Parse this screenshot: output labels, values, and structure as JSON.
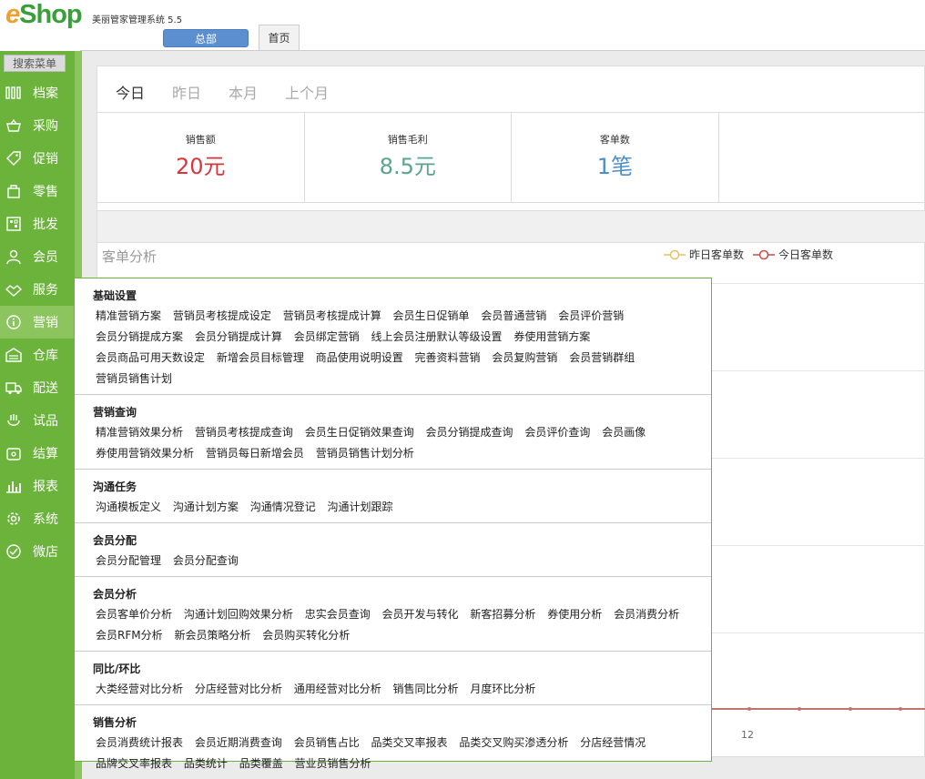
{
  "header": {
    "logo_e": "e",
    "logo_rest": "Shop",
    "subtitle": "美丽管家管理系统 5.5",
    "branch_button": "总部",
    "home_tab": "首页"
  },
  "sidebar": {
    "search_label": "搜索菜单",
    "items": [
      {
        "label": "档案",
        "icon": "barcode-icon"
      },
      {
        "label": "采购",
        "icon": "basket-icon"
      },
      {
        "label": "促销",
        "icon": "tag-icon"
      },
      {
        "label": "零售",
        "icon": "bag-icon"
      },
      {
        "label": "批发",
        "icon": "qr-icon"
      },
      {
        "label": "会员",
        "icon": "user-icon"
      },
      {
        "label": "服务",
        "icon": "handshake-icon"
      },
      {
        "label": "营销",
        "icon": "info-icon"
      },
      {
        "label": "仓库",
        "icon": "warehouse-icon"
      },
      {
        "label": "配送",
        "icon": "truck-icon"
      },
      {
        "label": "试品",
        "icon": "sample-icon"
      },
      {
        "label": "结算",
        "icon": "wallet-icon"
      },
      {
        "label": "报表",
        "icon": "barchart-icon"
      },
      {
        "label": "系统",
        "icon": "gear-icon"
      },
      {
        "label": "微店",
        "icon": "shop-icon"
      }
    ],
    "active": "营销"
  },
  "dashboard": {
    "periods": [
      "今日",
      "昨日",
      "本月",
      "上个月"
    ],
    "stats": [
      {
        "label": "销售额",
        "value": "20元",
        "color": "#d9353a"
      },
      {
        "label": "销售毛利",
        "value": "8.5元",
        "color": "#5aa58a"
      },
      {
        "label": "客单数",
        "value": "1笔",
        "color": "#4f8fc9"
      }
    ],
    "chart_title": "客单分析",
    "legend": [
      {
        "label": "昨日客单数",
        "color": "#e6c16a"
      },
      {
        "label": "今日客单数",
        "color": "#cc4a4a"
      }
    ],
    "axis_label": "12"
  },
  "menu": {
    "sections": [
      {
        "title": "基础设置",
        "links": [
          "精准营销方案",
          "营销员考核提成设定",
          "营销员考核提成计算",
          "会员生日促销单",
          "会员普通营销",
          "会员评价营销",
          "会员分销提成方案",
          "会员分销提成计算",
          "会员绑定营销",
          "线上会员注册默认等级设置",
          "券使用营销方案",
          "会员商品可用天数设定",
          "新增会员目标管理",
          "商品使用说明设置",
          "完善资料营销",
          "会员复购营销",
          "会员营销群组",
          "营销员销售计划"
        ]
      },
      {
        "title": "营销查询",
        "links": [
          "精准营销效果分析",
          "营销员考核提成查询",
          "会员生日促销效果查询",
          "会员分销提成查询",
          "会员评价查询",
          "会员画像",
          "券使用营销效果分析",
          "营销员每日新增会员",
          "营销员销售计划分析"
        ]
      },
      {
        "title": "沟通任务",
        "links": [
          "沟通模板定义",
          "沟通计划方案",
          "沟通情况登记",
          "沟通计划跟踪"
        ]
      },
      {
        "title": "会员分配",
        "links": [
          "会员分配管理",
          "会员分配查询"
        ]
      },
      {
        "title": "会员分析",
        "links": [
          "会员客单价分析",
          "沟通计划回购效果分析",
          "忠实会员查询",
          "会员开发与转化",
          "新客招募分析",
          "券使用分析",
          "会员消费分析",
          "会员RFM分析",
          "新会员策略分析",
          "会员购买转化分析"
        ]
      },
      {
        "title": "同比/环比",
        "links": [
          "大类经营对比分析",
          "分店经营对比分析",
          "通用经营对比分析",
          "销售同比分析",
          "月度环比分析"
        ]
      },
      {
        "title": "销售分析",
        "links": [
          "会员消费统计报表",
          "会员近期消费查询",
          "会员销售占比",
          "品类交叉率报表",
          "品类交叉购买渗透分析",
          "分店经营情况",
          "品牌交叉率报表",
          "品类统计",
          "品类覆盖",
          "营业员销售分析"
        ]
      }
    ]
  }
}
